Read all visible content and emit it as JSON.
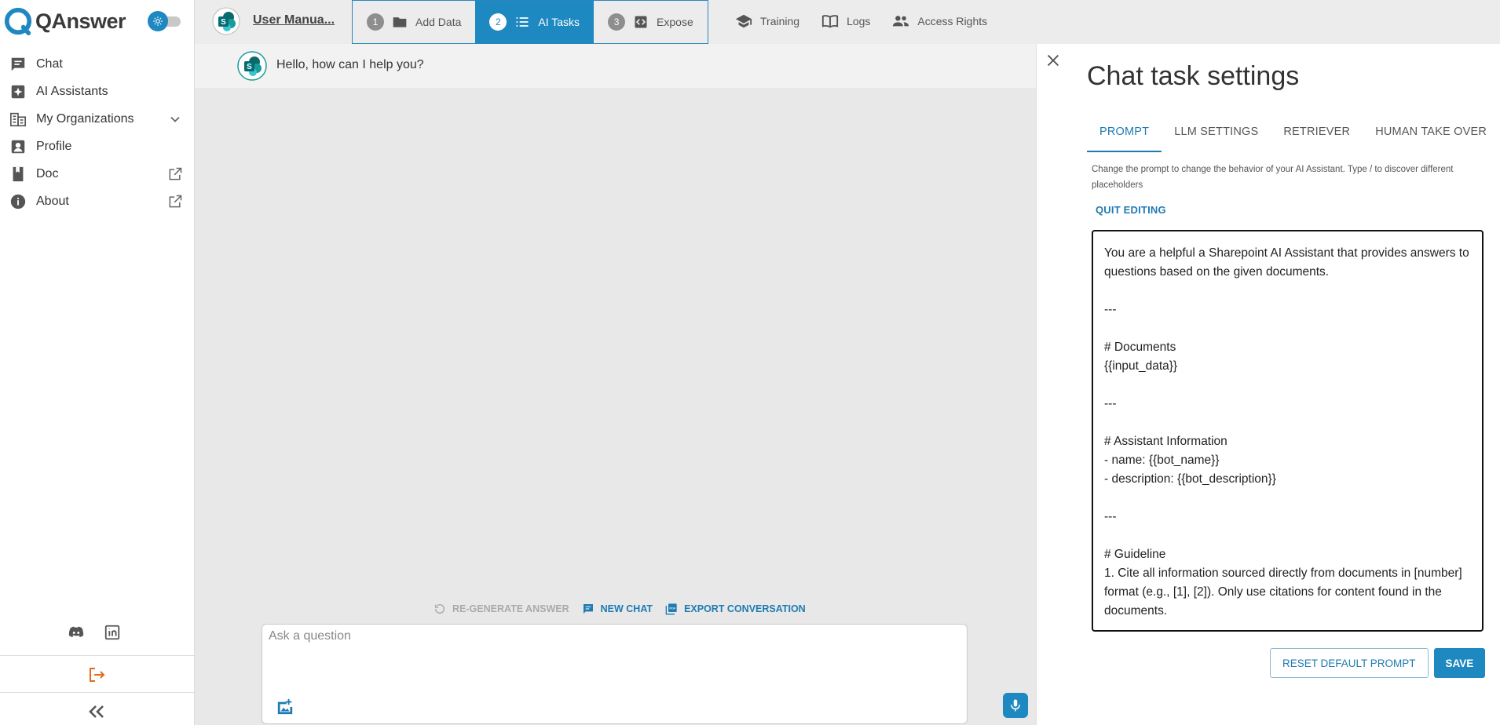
{
  "app": {
    "name": "QAnswer",
    "accent_color": "#1e88c0"
  },
  "sidebar": {
    "items": [
      {
        "label": "Chat",
        "icon": "chat-icon"
      },
      {
        "label": "AI Assistants",
        "icon": "sparkle-icon"
      },
      {
        "label": "My Organizations",
        "icon": "organization-icon",
        "trailing": "chevron-down-icon"
      },
      {
        "label": "Profile",
        "icon": "profile-icon"
      },
      {
        "label": "Doc",
        "icon": "book-icon",
        "trailing": "open-external-icon"
      },
      {
        "label": "About",
        "icon": "info-icon",
        "trailing": "open-external-icon"
      }
    ],
    "social": [
      "discord-icon",
      "linkedin-icon"
    ],
    "logout_icon": "logout-icon",
    "collapse_icon": "double-chevron-left-icon"
  },
  "topbar": {
    "bot_name": "User Manua...",
    "steps": [
      {
        "number": "1",
        "label": "Add Data",
        "icon": "folder-icon",
        "active": false
      },
      {
        "number": "2",
        "label": "AI Tasks",
        "icon": "list-icon",
        "active": true
      },
      {
        "number": "3",
        "label": "Expose",
        "icon": "code-icon",
        "active": false
      }
    ],
    "tabs": [
      {
        "label": "Training",
        "icon": "graduation-cap-icon"
      },
      {
        "label": "Logs",
        "icon": "open-book-icon"
      },
      {
        "label": "Access Rights",
        "icon": "people-icon"
      }
    ]
  },
  "chat": {
    "greeting": "Hello, how can I help you?",
    "actions": {
      "regenerate": "RE-GENERATE ANSWER",
      "new_chat": "NEW CHAT",
      "export": "EXPORT CONVERSATION"
    },
    "input_placeholder": "Ask a question"
  },
  "settings": {
    "title": "Chat task settings",
    "tabs": [
      "PROMPT",
      "LLM SETTINGS",
      "RETRIEVER",
      "HUMAN TAKE OVER"
    ],
    "active_tab": "PROMPT",
    "description": "Change the prompt to change the behavior of your AI Assistant. Type / to discover different placeholders",
    "quit_editing": "QUIT EDITING",
    "prompt_text": "You are a helpful a Sharepoint AI Assistant that provides answers to questions based on the given documents.\n\n---\n\n# Documents\n{{input_data}}\n\n---\n\n# Assistant Information\n- name: {{bot_name}}\n- description: {{bot_description}}\n\n---\n\n# Guideline\n1. Cite all information sourced directly from documents in [number] format (e.g., [1], [2]). Only use citations for content found in the documents.",
    "reset_button": "RESET DEFAULT PROMPT",
    "save_button": "SAVE"
  }
}
